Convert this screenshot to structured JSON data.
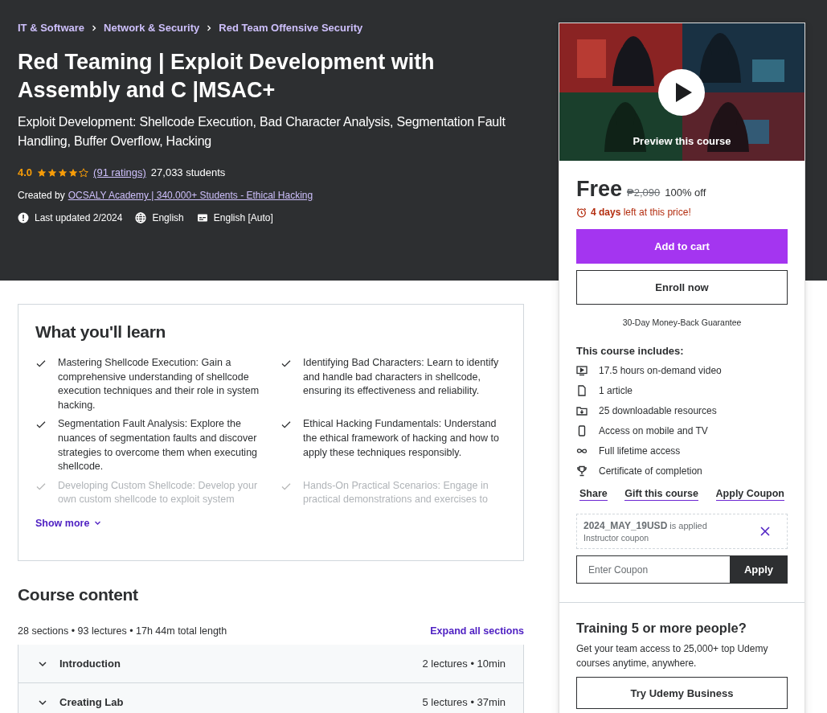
{
  "breadcrumbs": [
    "IT & Software",
    "Network & Security",
    "Red Team Offensive Security"
  ],
  "title": "Red Teaming | Exploit Development with Assembly and C |MSAC+",
  "subtitle": "Exploit Development: Shellcode Execution, Bad Character Analysis, Segmentation Fault Handling, Buffer Overflow, Hacking",
  "rating": {
    "value": "4.0",
    "stars": 4,
    "ratings_link": "(91 ratings)",
    "students": "27,033 students"
  },
  "created_by": {
    "label": "Created by",
    "author": "OCSALY Academy | 340.000+ Students - Ethical Hacking"
  },
  "meta": [
    {
      "kind": "alert",
      "text": "Last updated 2/2024"
    },
    {
      "kind": "globe",
      "text": "English"
    },
    {
      "kind": "captions",
      "text": "English [Auto]"
    }
  ],
  "learn": {
    "heading": "What you'll learn",
    "items": [
      {
        "text": "Mastering Shellcode Execution: Gain a comprehensive understanding of shellcode execution techniques and their role in system hacking.",
        "faded": false
      },
      {
        "text": "Identifying Bad Characters: Learn to identify and handle bad characters in shellcode, ensuring its effectiveness and reliability.",
        "faded": false
      },
      {
        "text": "Segmentation Fault Analysis: Explore the nuances of segmentation faults and discover strategies to overcome them when executing shellcode.",
        "faded": false
      },
      {
        "text": "Ethical Hacking Fundamentals: Understand the ethical framework of hacking and how to apply these techniques responsibly.",
        "faded": false
      },
      {
        "text": "Developing Custom Shellcode: Develop your own custom shellcode to exploit system",
        "faded": true
      },
      {
        "text": "Hands-On Practical Scenarios: Engage in practical demonstrations and exercises to",
        "faded": true
      }
    ],
    "show_more": "Show more"
  },
  "course_content": {
    "heading": "Course content",
    "summary": "28 sections • 93 lectures • 17h 44m total length",
    "expand_all": "Expand all sections",
    "sections": [
      {
        "title": "Introduction",
        "info": "2 lectures • 10min",
        "expanded": false
      },
      {
        "title": "Creating Lab",
        "info": "5 lectures • 37min",
        "expanded": false
      }
    ]
  },
  "sidebar": {
    "preview": "Preview this course",
    "price": "Free",
    "original_price": "₱2,090",
    "discount": "100% off",
    "deadline": "**4 days** left at this price!",
    "add_to_cart": "Add to cart",
    "enroll": "Enroll now",
    "guarantee": "30-Day Money-Back Guarantee",
    "includes_heading": "This course includes:",
    "includes": [
      {
        "kind": "video",
        "text": "17.5 hours on-demand video"
      },
      {
        "kind": "article",
        "text": "1 article"
      },
      {
        "kind": "download",
        "text": "25 downloadable resources"
      },
      {
        "kind": "mobile",
        "text": "Access on mobile and TV"
      },
      {
        "kind": "infinity",
        "text": "Full lifetime access"
      },
      {
        "kind": "trophy",
        "text": "Certificate of completion"
      }
    ],
    "links": [
      "Share",
      "Gift this course",
      "Apply Coupon"
    ],
    "coupon": {
      "applied": "**2024_MAY_19USD** is applied",
      "note": "Instructor coupon"
    },
    "coupon_field": {
      "placeholder": "Enter Coupon",
      "button": "Apply"
    },
    "business": {
      "heading": "Training 5 or more people?",
      "text": "Get your team access to 25,000+ top Udemy courses anytime, anywhere.",
      "button": "Try Udemy Business"
    }
  }
}
